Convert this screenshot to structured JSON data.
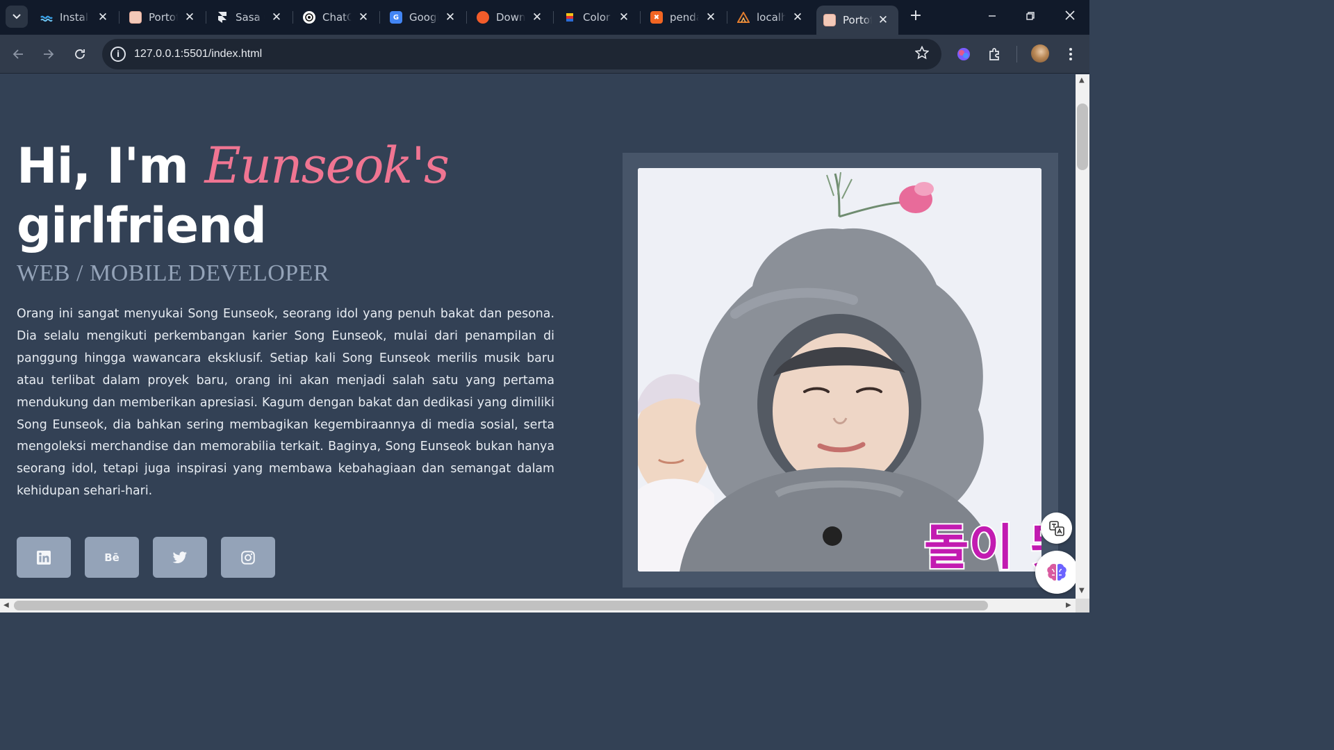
{
  "browser": {
    "tabs": [
      {
        "title": "Install",
        "icon": "wave-icon",
        "color": "#3aa0e6"
      },
      {
        "title": "Portofolio",
        "icon": "portfolio-favicon",
        "color": "#f3c9b8"
      },
      {
        "title": "Sasa Glass",
        "icon": "framer-icon",
        "color": "#ffffff"
      },
      {
        "title": "ChatGPT",
        "icon": "chatgpt-icon",
        "color": "#ffffff"
      },
      {
        "title": "Google Translate",
        "icon": "google-translate-icon",
        "color": "#4285f4"
      },
      {
        "title": "Download",
        "icon": "download-favicon",
        "color": "#f25c2a"
      },
      {
        "title": "Color",
        "icon": "color-favicon",
        "color": "#f5c518"
      },
      {
        "title": "pendaftaran",
        "icon": "xampp-icon",
        "color": "#f26522"
      },
      {
        "title": "localhost",
        "icon": "localhost-icon",
        "color": "#e07b2d"
      },
      {
        "title": "Portofolio",
        "icon": "portfolio-favicon",
        "color": "#f3c9b8",
        "active": true
      }
    ],
    "url": "127.0.0.1:5501/index.html"
  },
  "hero": {
    "greeting": "Hi, I'm ",
    "name": "Eunseok's",
    "title_rest": "girlfriend",
    "subtitle": "WEB / MOBILE DEVELOPER",
    "bio": "Orang ini sangat menyukai Song Eunseok, seorang idol yang penuh bakat dan pesona. Dia selalu mengikuti perkembangan karier Song Eunseok, mulai dari penampilan di panggung hingga wawancara eksklusif. Setiap kali Song Eunseok merilis musik baru atau terlibat dalam proyek baru, orang ini akan menjadi salah satu yang pertama mendukung dan memberikan apresiasi. Kagum dengan bakat dan dedikasi yang dimiliki Song Eunseok, dia bahkan sering membagikan kegembiraannya di media sosial, serta mengoleksi merchandise dan memorabilia terkait. Baginya, Song Eunseok bukan hanya seorang idol, tetapi juga inspirasi yang membawa kebahagiaan dan semangat dalam kehidupan sehari-hari.",
    "accent_color": "#f07592"
  },
  "social": [
    {
      "name": "linkedin-icon",
      "label": "in"
    },
    {
      "name": "behance-icon",
      "label": "Bē"
    },
    {
      "name": "twitter-icon",
      "label": ""
    },
    {
      "name": "instagram-icon",
      "label": ""
    }
  ],
  "photo": {
    "caption": "돌이 됐"
  }
}
